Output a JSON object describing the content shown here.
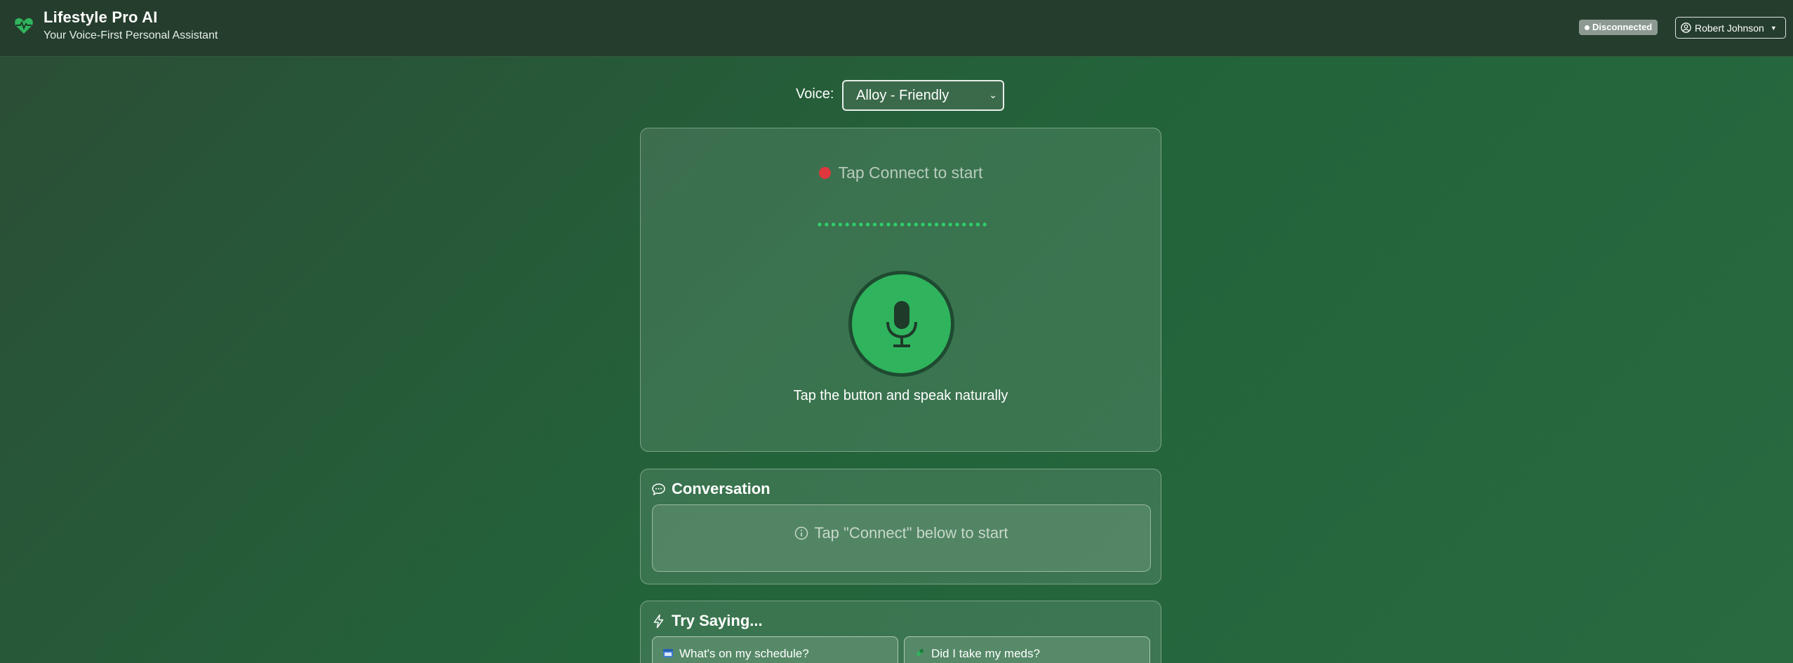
{
  "header": {
    "app_title": "Lifestyle Pro AI",
    "app_subtitle": "Your Voice-First Personal Assistant",
    "brand_icon": "heart-pulse-icon",
    "status_badge": "Disconnected",
    "user_name": "Robert Johnson",
    "user_icon": "user-circle-icon"
  },
  "voice": {
    "label": "Voice:",
    "selected": "Alloy - Friendly"
  },
  "voice_panel": {
    "status_text": "Tap Connect to start",
    "status_color": "#e0363d",
    "mic_icon": "microphone-icon",
    "hint": "Tap the button and speak naturally"
  },
  "conversation": {
    "title": "Conversation",
    "empty_message": "Tap \"Connect\" below to start"
  },
  "try_saying": {
    "title": "Try Saying...",
    "suggestions": [
      {
        "label": "What's on my schedule?",
        "icon": "calendar-icon"
      },
      {
        "label": "Did I take my meds?",
        "icon": "pill-icon"
      }
    ]
  },
  "colors": {
    "accent_green": "#2fb45d",
    "header_bg": "#253d2d",
    "badge_bg": "#8c9a92"
  }
}
